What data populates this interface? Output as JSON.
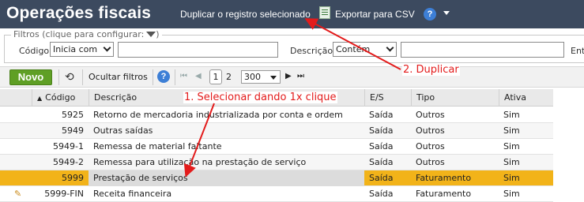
{
  "header": {
    "title": "Operações fiscais",
    "duplicate_label": "Duplicar o registro selecionado",
    "export_label": "Exportar para CSV",
    "help_label": "?"
  },
  "filters": {
    "legend": "Filtros (clique para configurar:",
    "code_label": "Código",
    "code_operator": "Inicia com",
    "code_value": "",
    "description_label": "Descrição",
    "description_operator": "Contém",
    "description_value": "",
    "extra_label": "Ent"
  },
  "toolbar": {
    "new_label": "Novo",
    "hide_filters_label": "Ocultar filtros",
    "help_label": "?",
    "pages": [
      "1",
      "2"
    ],
    "current_page": "1",
    "page_size": "300"
  },
  "table": {
    "columns": [
      "Código",
      "Descrição",
      "E/S",
      "Tipo",
      "Ativa"
    ],
    "rows": [
      {
        "code": "5925",
        "description": "Retorno de mercadoria industrializada por conta e ordem",
        "es": "Saída",
        "type": "Outros",
        "active": "Sim"
      },
      {
        "code": "5949",
        "description": "Outras saídas",
        "es": "Saída",
        "type": "Outros",
        "active": "Sim"
      },
      {
        "code": "5949-1",
        "description": "Remessa de material faltante",
        "es": "Saída",
        "type": "Outros",
        "active": "Sim"
      },
      {
        "code": "5949-2",
        "description": "Remessa para utilização na prestação de serviço",
        "es": "Saída",
        "type": "Outros",
        "active": "Sim"
      },
      {
        "code": "5999",
        "description": "Prestação de serviços",
        "es": "Saída",
        "type": "Faturamento",
        "active": "Sim"
      },
      {
        "code": "5999-FIN",
        "description": "Receita financeira",
        "es": "Saída",
        "type": "Faturamento",
        "active": "Sim"
      }
    ]
  },
  "annotations": {
    "step1": "1. Selecionar dando 1x clique",
    "step2": "2. Duplicar"
  },
  "colors": {
    "header_bg": "#3c4a5f",
    "selected_row": "#f2b319",
    "new_button": "#5f9f25",
    "annotation": "#e31b1b"
  }
}
